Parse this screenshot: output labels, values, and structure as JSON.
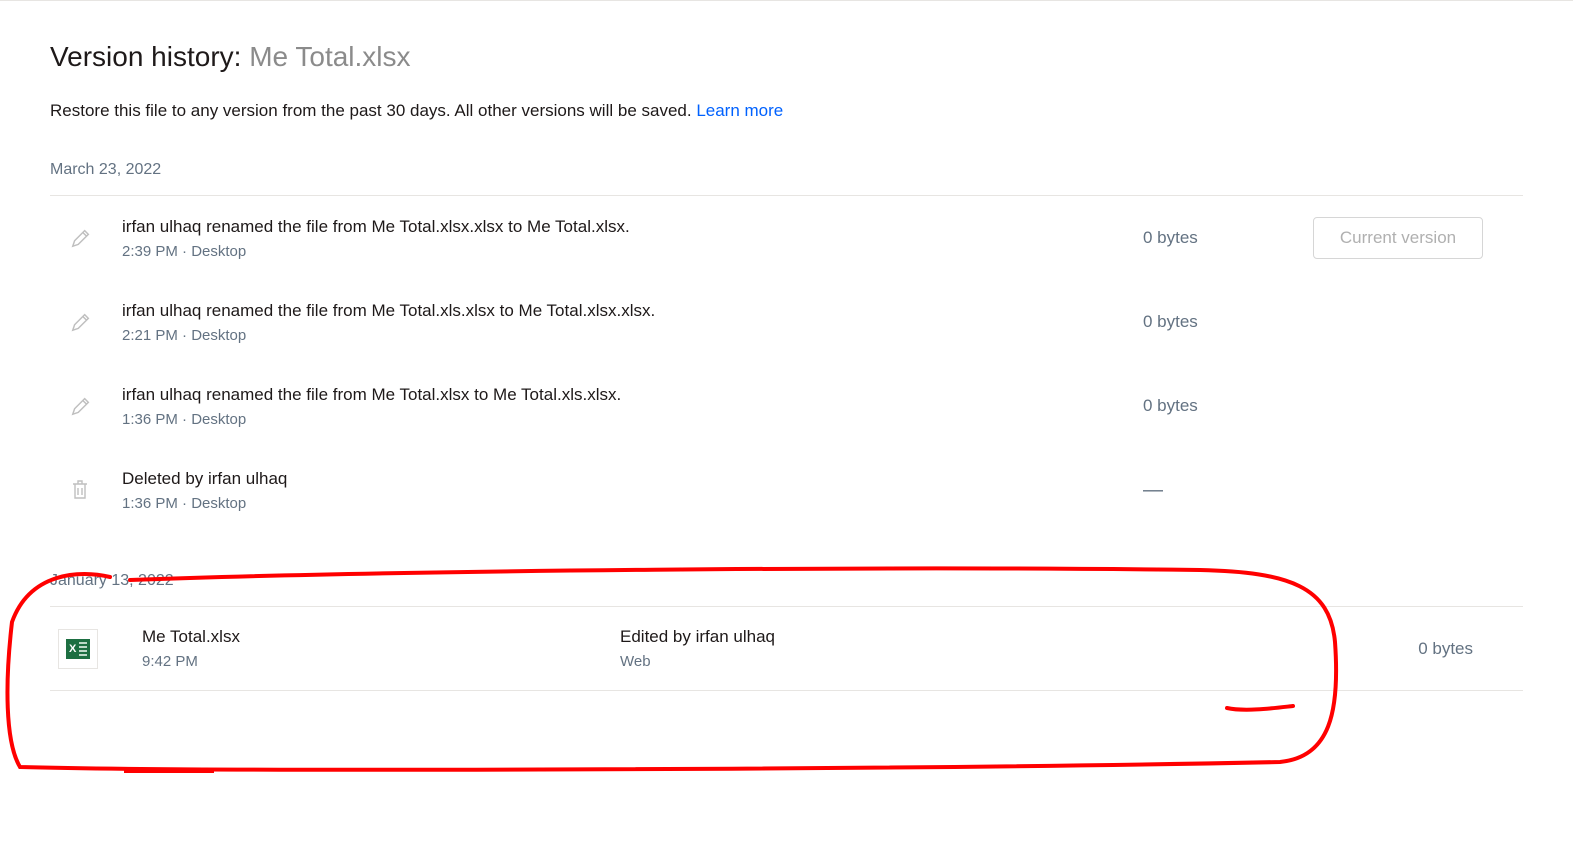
{
  "header": {
    "title_prefix": "Version history: ",
    "filename": "Me Total.xlsx",
    "subtitle_text": "Restore this file to any version from the past 30 days. All other versions will be saved. ",
    "learn_more": "Learn more"
  },
  "groups": [
    {
      "date": "March 23, 2022",
      "entries": [
        {
          "icon": "pencil",
          "desc": "irfan ulhaq renamed the file from Me Total.xlsx.xlsx to Me Total.xlsx.",
          "time": "2:39 PM",
          "source": "Desktop",
          "size": "0 bytes",
          "action": "current",
          "action_label": "Current version"
        },
        {
          "icon": "pencil",
          "desc": "irfan ulhaq renamed the file from Me Total.xls.xlsx to Me Total.xlsx.xlsx.",
          "time": "2:21 PM",
          "source": "Desktop",
          "size": "0 bytes",
          "action": "none"
        },
        {
          "icon": "pencil",
          "desc": "irfan ulhaq renamed the file from Me Total.xlsx to Me Total.xls.xlsx.",
          "time": "1:36 PM",
          "source": "Desktop",
          "size": "0 bytes",
          "action": "none"
        },
        {
          "icon": "trash",
          "desc": "Deleted by irfan ulhaq",
          "time": "1:36 PM",
          "source": "Desktop",
          "size": "—",
          "action": "none"
        }
      ]
    },
    {
      "date": "January 13, 2022",
      "entries": [
        {
          "icon": "xlsx",
          "desc": "Me Total.xlsx",
          "time": "9:42 PM",
          "source": "",
          "edit_desc": "Edited by irfan ulhaq",
          "edit_src": "Web",
          "size": "0 bytes",
          "action": "none",
          "is_file_row": true
        }
      ]
    }
  ]
}
